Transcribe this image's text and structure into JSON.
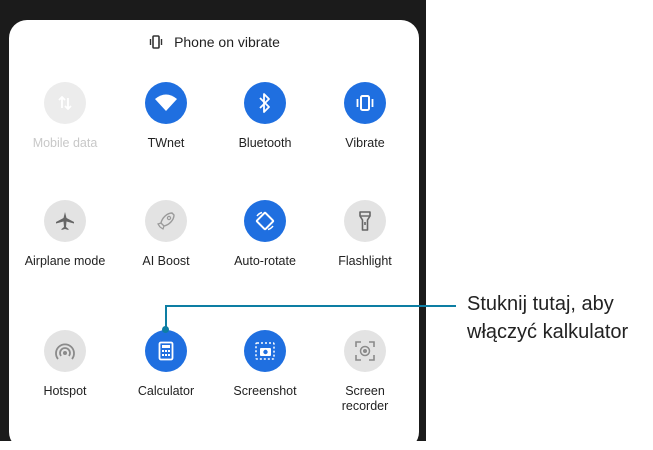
{
  "status": {
    "text": "Phone on vibrate",
    "icon": "vibrate-icon"
  },
  "tiles": [
    {
      "label": "Mobile data",
      "state": "disabled",
      "icon": "mobile-data-icon"
    },
    {
      "label": "TWnet",
      "state": "on",
      "icon": "wifi-icon"
    },
    {
      "label": "Bluetooth",
      "state": "on",
      "icon": "bluetooth-icon"
    },
    {
      "label": "Vibrate",
      "state": "on",
      "icon": "vibrate-icon"
    },
    {
      "label": "Airplane mode",
      "state": "off",
      "icon": "airplane-icon"
    },
    {
      "label": "AI Boost",
      "state": "off",
      "icon": "rocket-icon"
    },
    {
      "label": "Auto-rotate",
      "state": "on",
      "icon": "auto-rotate-icon"
    },
    {
      "label": "Flashlight",
      "state": "off",
      "icon": "flashlight-icon"
    },
    {
      "label": "Hotspot",
      "state": "off",
      "icon": "hotspot-icon"
    },
    {
      "label": "Calculator",
      "state": "on",
      "icon": "calculator-icon"
    },
    {
      "label": "Screenshot",
      "state": "on",
      "icon": "screenshot-icon"
    },
    {
      "label": "Screen recorder",
      "state": "off",
      "icon": "screen-recorder-icon"
    }
  ],
  "callout": {
    "line1": "Stuknij tutaj, aby",
    "line2": "włączyć kalkulator"
  },
  "colors": {
    "accent": "#1f6fe0",
    "inactive": "#e3e3e3",
    "callout": "#0d7ea3"
  }
}
